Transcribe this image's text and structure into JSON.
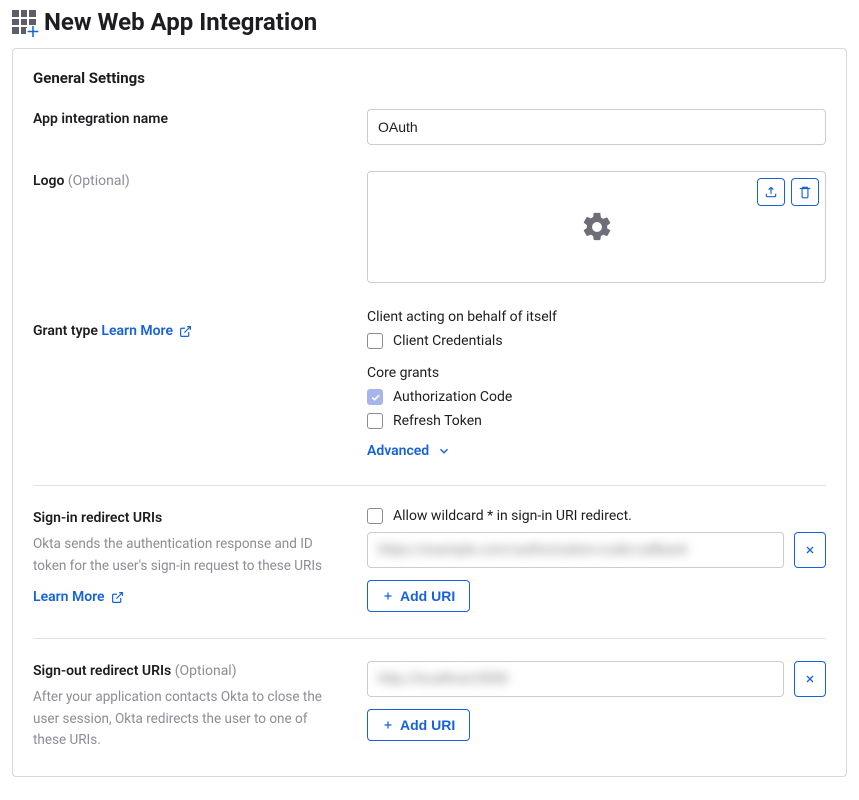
{
  "header": {
    "page_title": "New Web App Integration"
  },
  "section": {
    "general_settings": "General Settings"
  },
  "fields": {
    "name_label": "App integration name",
    "name_value": "OAuth",
    "logo_label": "Logo",
    "optional": "(Optional)"
  },
  "grant": {
    "label": "Grant type",
    "learn_more": "Learn More",
    "self_heading": "Client acting on behalf of itself",
    "client_credentials": "Client Credentials",
    "core_heading": "Core grants",
    "authorization_code": "Authorization Code",
    "refresh_token": "Refresh Token",
    "advanced": "Advanced"
  },
  "signin": {
    "label": "Sign-in redirect URIs",
    "help": "Okta sends the authentication response and ID token for the user's sign-in request to these URIs",
    "learn_more": "Learn More",
    "allow_wildcard": "Allow wildcard * in sign-in URI redirect.",
    "uri_value": "https://example.com/authorization-code/callback",
    "add_label": "Add URI"
  },
  "signout": {
    "label": "Sign-out redirect URIs",
    "help": "After your application contacts Okta to close the user session, Okta redirects the user to one of these URIs.",
    "uri_value": "http://localhost:0000",
    "add_label": "Add URI"
  }
}
